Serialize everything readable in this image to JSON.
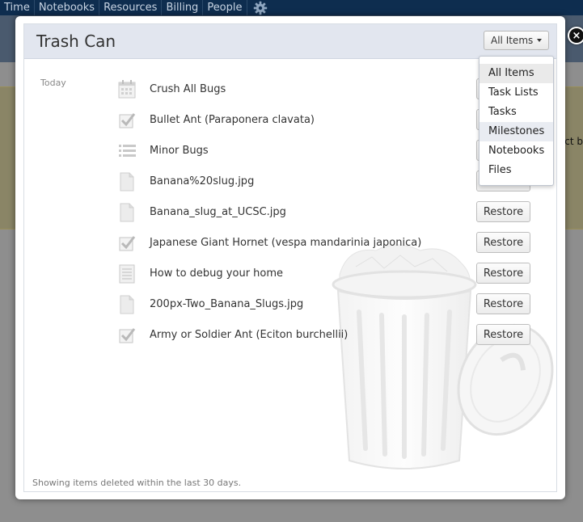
{
  "nav": {
    "items": [
      "Time",
      "Notebooks",
      "Resources",
      "Billing",
      "People"
    ],
    "gear_icon": "gear-icon"
  },
  "background": {
    "peek_text": "ct b"
  },
  "modal": {
    "title": "Trash Can",
    "filter_label": "All Items",
    "date_group": "Today",
    "restore_label": "Restore",
    "footer": "Showing items deleted within the last 30 days.",
    "items": [
      {
        "name": "Crush All Bugs",
        "icon": "calendar-icon"
      },
      {
        "name": "Bullet Ant (Paraponera clavata)",
        "icon": "checkbox-icon"
      },
      {
        "name": "Minor Bugs",
        "icon": "list-icon"
      },
      {
        "name": "Banana%20slug.jpg",
        "icon": "file-icon"
      },
      {
        "name": "Banana_slug_at_UCSC.jpg",
        "icon": "file-icon"
      },
      {
        "name": "Japanese Giant Hornet (vespa mandarinia japonica)",
        "icon": "checkbox-icon"
      },
      {
        "name": "How to debug your home",
        "icon": "notebook-icon"
      },
      {
        "name": "200px-Two_Banana_Slugs.jpg",
        "icon": "file-icon"
      },
      {
        "name": "Army or Soldier Ant (Eciton burchellii)",
        "icon": "checkbox-icon"
      }
    ]
  },
  "dropdown": {
    "options": [
      "All Items",
      "Task Lists",
      "Tasks",
      "Milestones",
      "Notebooks",
      "Files"
    ],
    "selected": "All Items"
  }
}
